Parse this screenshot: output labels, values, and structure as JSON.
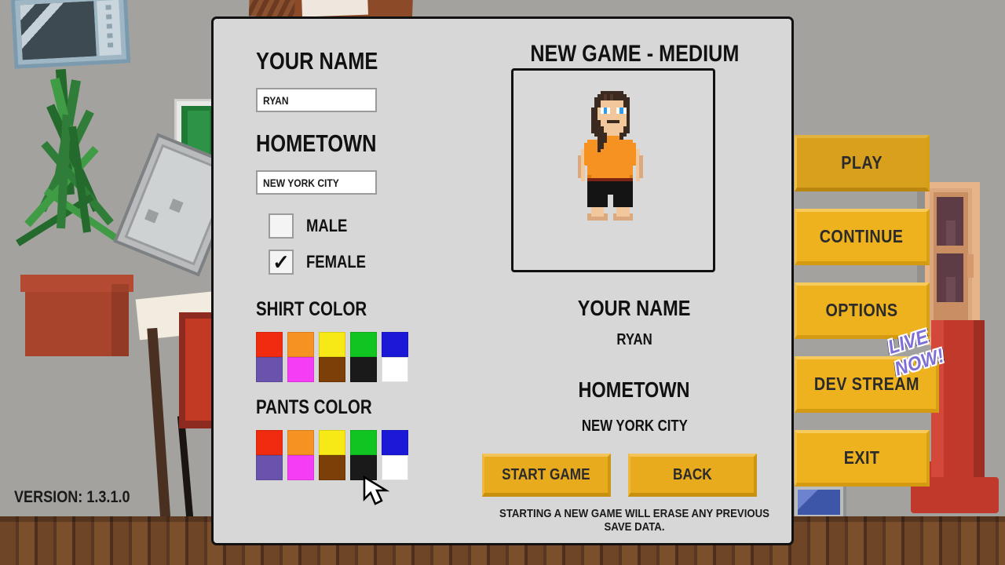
{
  "version_text": "VERSION: 1.3.1.0",
  "main_menu": {
    "items": [
      {
        "label": "PLAY",
        "selected": true
      },
      {
        "label": "CONTINUE",
        "selected": false
      },
      {
        "label": "OPTIONS",
        "selected": false
      },
      {
        "label": "DEV STREAM",
        "selected": false
      },
      {
        "label": "EXIT",
        "selected": false
      }
    ],
    "live_badge": "LIVE NOW!"
  },
  "dialog": {
    "title": "NEW GAME - MEDIUM",
    "left": {
      "name_label": "YOUR NAME",
      "name_value": "RYAN",
      "name_placeholder": "YOUR NAME",
      "hometown_label": "HOMETOWN",
      "hometown_value": "NEW YORK CITY",
      "hometown_placeholder": "HOMETOWN",
      "gender": [
        {
          "label": "MALE",
          "checked": false,
          "mark": ""
        },
        {
          "label": "FEMALE",
          "checked": true,
          "mark": "✓"
        }
      ],
      "shirt_label": "SHIRT COLOR",
      "shirt_colors": [
        "#f02b10",
        "#f59221",
        "#f7e916",
        "#10c421",
        "#1b19d6",
        "#6a53ad",
        "#f53df5",
        "#7c3f07",
        "#1a1a1a",
        "#ffffff"
      ],
      "shirt_selected_index": 1,
      "pants_label": "PANTS COLOR",
      "pants_colors": [
        "#f02b10",
        "#f59221",
        "#f7e916",
        "#10c421",
        "#1b19d6",
        "#6a53ad",
        "#f53df5",
        "#7c3f07",
        "#1a1a1a",
        "#ffffff"
      ],
      "pants_selected_index": 8
    },
    "preview": {
      "name_label": "YOUR NAME",
      "name_value": "RYAN",
      "hometown_label": "HOMETOWN",
      "hometown_value": "NEW YORK CITY"
    },
    "buttons": {
      "start": "START GAME",
      "back": "BACK"
    },
    "warning": "STARTING A NEW GAME WILL ERASE ANY PREVIOUS SAVE DATA."
  },
  "character": {
    "hair": "#3a2a20",
    "hair_light": "#54392a",
    "skin": "#f2c79c",
    "skin_shade": "#dba97d",
    "eye": "#2d9bf0",
    "shirt": "#f59221",
    "shirt_shade": "#d97a14",
    "pants": "#141414",
    "belt": "#7c2414",
    "mouth": "#3a2a20"
  },
  "colors": {
    "dialog_bg": "#d7d7d7",
    "menu_button": "#efb21f",
    "menu_button_selected": "#d9a01e",
    "wall": "#a3a29e",
    "floor": "#5c3a22",
    "live_badge": "#7d6fd6"
  }
}
